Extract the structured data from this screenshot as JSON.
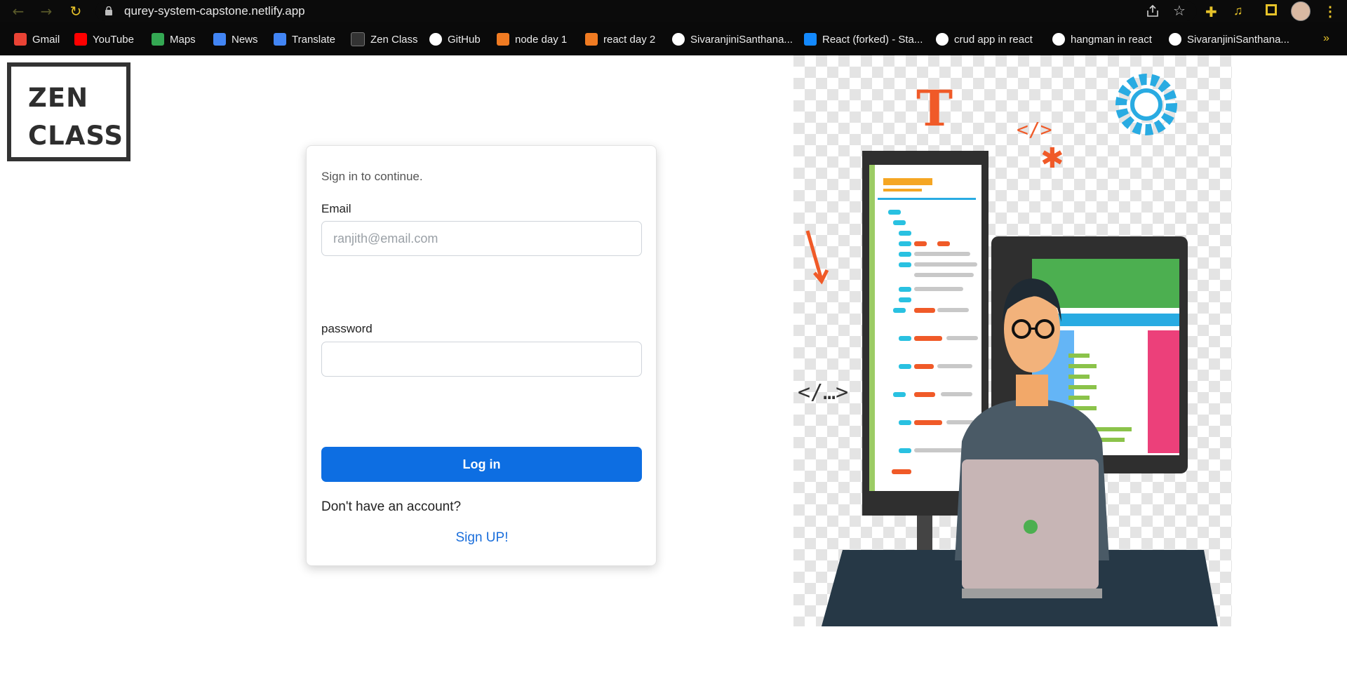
{
  "browser": {
    "url": "qurey-system-capstone.netlify.app",
    "icons": [
      "back-icon",
      "forward-icon",
      "reload-icon",
      "lock-icon",
      "share-icon",
      "star-icon",
      "extensions-icon",
      "media-icon",
      "side-panel-icon",
      "avatar",
      "menu-icon"
    ]
  },
  "bookmarks": [
    {
      "label": "Gmail",
      "icon": "gmail-icon",
      "color": "#ea4335"
    },
    {
      "label": "YouTube",
      "icon": "youtube-icon",
      "color": "#ff0000"
    },
    {
      "label": "Maps",
      "icon": "maps-icon",
      "color": "#34a853"
    },
    {
      "label": "News",
      "icon": "news-icon",
      "color": "#4285f4"
    },
    {
      "label": "Translate",
      "icon": "translate-icon",
      "color": "#4285f4"
    },
    {
      "label": "Zen Class",
      "icon": "zen-class-icon",
      "color": "#333333"
    },
    {
      "label": "GitHub",
      "icon": "github-icon",
      "color": "#ffffff"
    },
    {
      "label": "node day 1",
      "icon": "bn-icon",
      "color": "#f07b22"
    },
    {
      "label": "react day 2",
      "icon": "bn-icon",
      "color": "#f07b22"
    },
    {
      "label": "SivaranjiniSanthana...",
      "icon": "github-icon",
      "color": "#ffffff"
    },
    {
      "label": "React (forked) - Sta...",
      "icon": "stackblitz-icon",
      "color": "#1389fd"
    },
    {
      "label": "crud app in react",
      "icon": "github-icon",
      "color": "#ffffff"
    },
    {
      "label": "hangman in react",
      "icon": "github-icon",
      "color": "#ffffff"
    },
    {
      "label": "SivaranjiniSanthana...",
      "icon": "github-icon",
      "color": "#ffffff"
    }
  ],
  "logo": {
    "text": "ZEN\nCLASS"
  },
  "login": {
    "subtitle": "Sign in to continue.",
    "email_label": "Email",
    "email_placeholder": "ranjith@email.com",
    "email_value": "",
    "password_label": "password",
    "password_value": "",
    "login_button": "Log in",
    "no_account_text": "Don't have an account?",
    "signup_link": "Sign UP!"
  },
  "colors": {
    "primary": "#0d6ee2",
    "link": "#1a6edb",
    "chrome_accent": "#e6c229"
  }
}
